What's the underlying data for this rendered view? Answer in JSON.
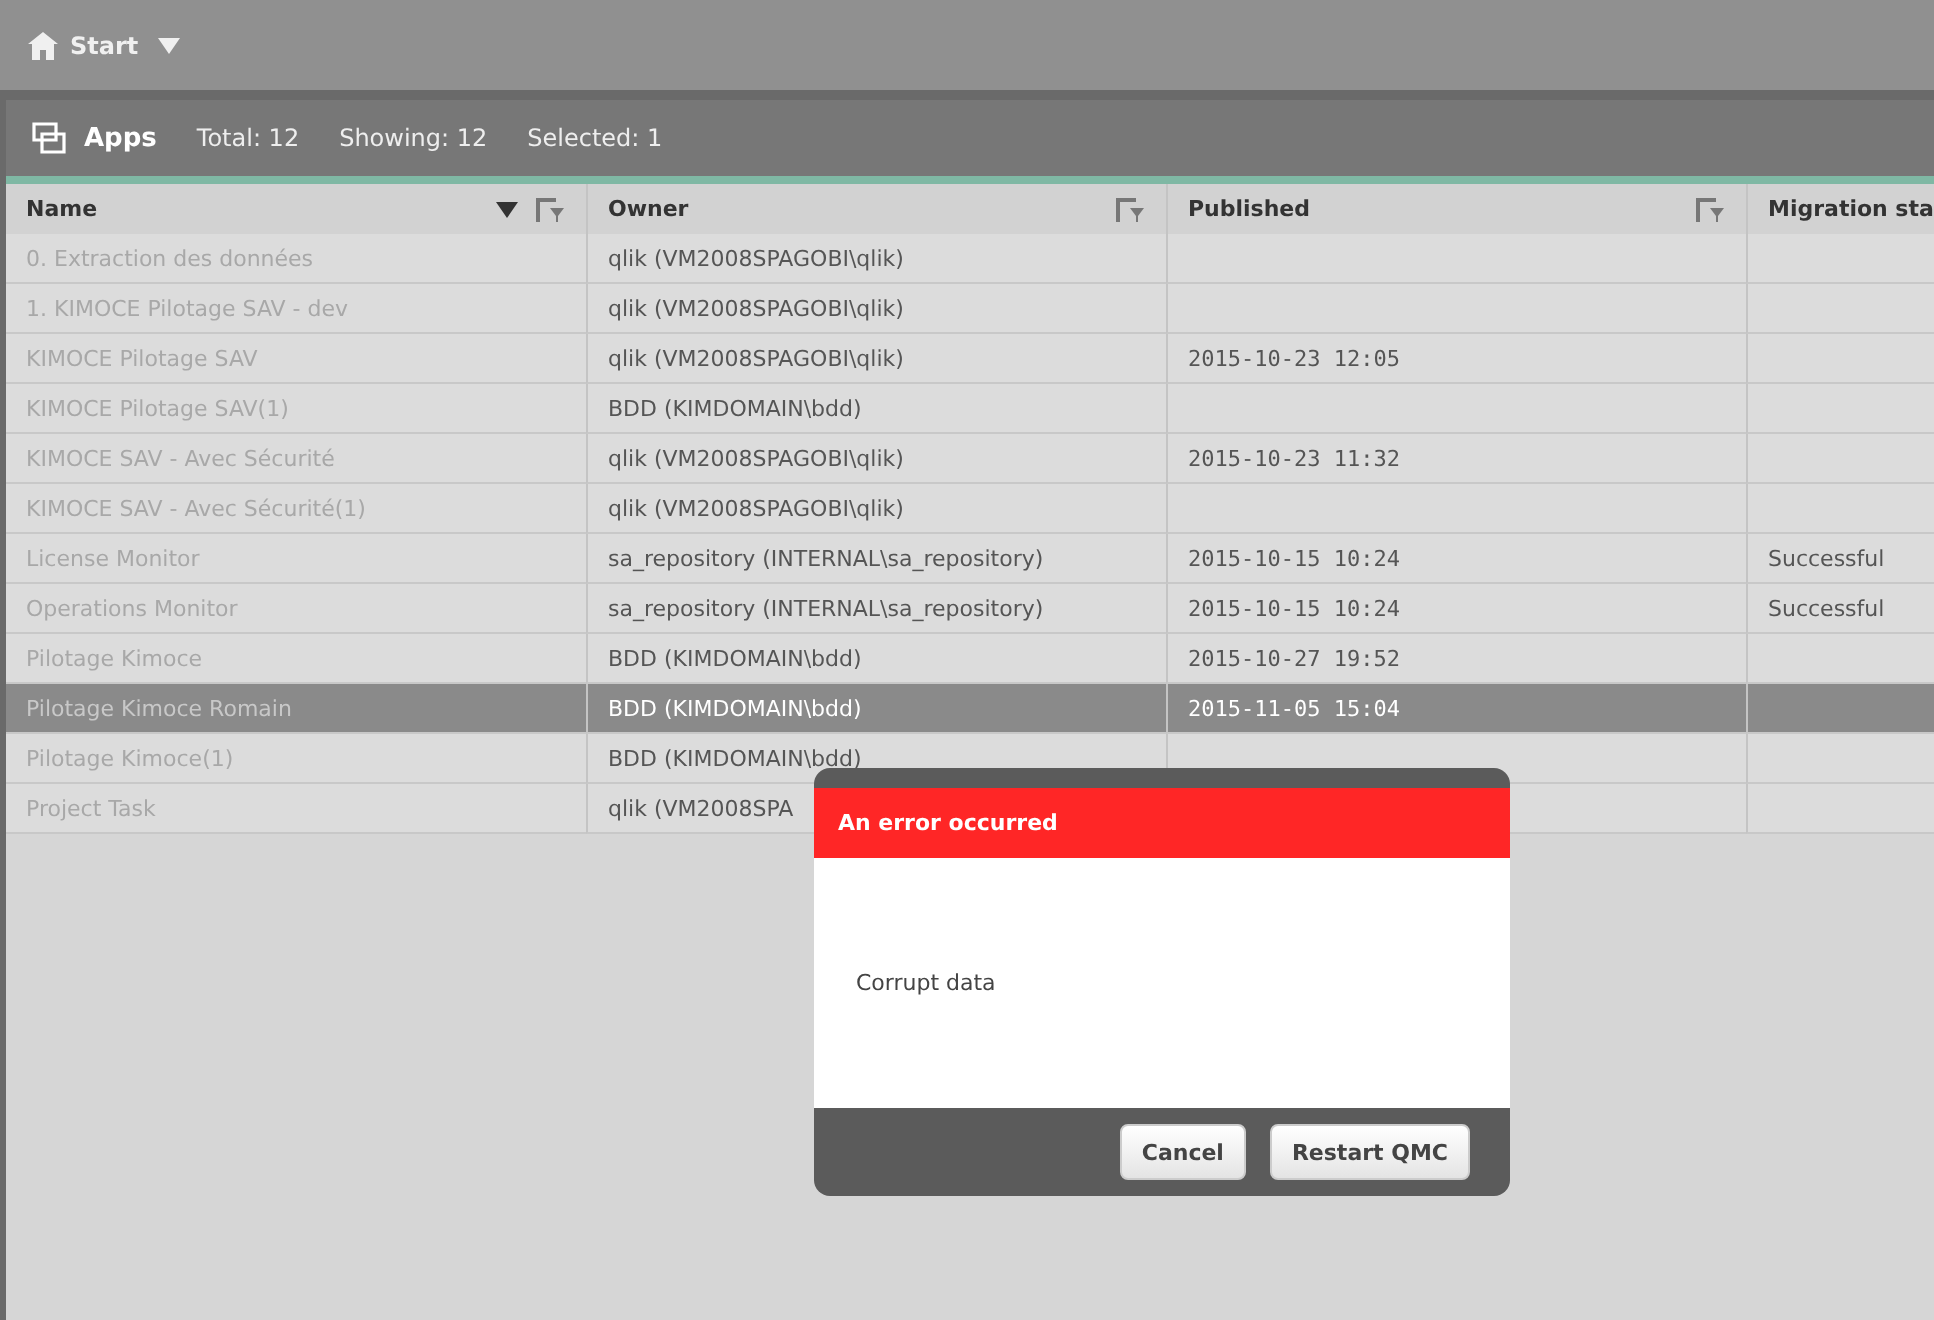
{
  "top_bar": {
    "home": "Start"
  },
  "apps_bar": {
    "title": "Apps",
    "total": "Total: 12",
    "showing": "Showing: 12",
    "selected": "Selected: 1"
  },
  "table": {
    "columns": [
      {
        "label": "Name",
        "sorted": true,
        "filter": true
      },
      {
        "label": "Owner",
        "sorted": false,
        "filter": true
      },
      {
        "label": "Published",
        "sorted": false,
        "filter": true
      },
      {
        "label": "Migration sta",
        "sorted": false,
        "filter": false
      }
    ],
    "rows": [
      {
        "name": "0. Extraction des données",
        "owner": "qlik (VM2008SPAGOBI\\qlik)",
        "published": "",
        "migration": "",
        "selected": false
      },
      {
        "name": "1. KIMOCE Pilotage SAV - dev",
        "owner": "qlik (VM2008SPAGOBI\\qlik)",
        "published": "",
        "migration": "",
        "selected": false
      },
      {
        "name": "KIMOCE Pilotage SAV",
        "owner": "qlik (VM2008SPAGOBI\\qlik)",
        "published": "2015-10-23 12:05",
        "migration": "",
        "selected": false
      },
      {
        "name": "KIMOCE Pilotage SAV(1)",
        "owner": "BDD (KIMDOMAIN\\bdd)",
        "published": "",
        "migration": "",
        "selected": false
      },
      {
        "name": "KIMOCE SAV - Avec Sécurité",
        "owner": "qlik (VM2008SPAGOBI\\qlik)",
        "published": "2015-10-23 11:32",
        "migration": "",
        "selected": false
      },
      {
        "name": "KIMOCE SAV - Avec Sécurité(1)",
        "owner": "qlik (VM2008SPAGOBI\\qlik)",
        "published": "",
        "migration": "",
        "selected": false
      },
      {
        "name": "License Monitor",
        "owner": "sa_repository (INTERNAL\\sa_repository)",
        "published": "2015-10-15 10:24",
        "migration": "Successful",
        "selected": false
      },
      {
        "name": "Operations Monitor",
        "owner": "sa_repository (INTERNAL\\sa_repository)",
        "published": "2015-10-15 10:24",
        "migration": "Successful",
        "selected": false
      },
      {
        "name": "Pilotage Kimoce",
        "owner": "BDD (KIMDOMAIN\\bdd)",
        "published": "2015-10-27 19:52",
        "migration": "",
        "selected": false
      },
      {
        "name": "Pilotage Kimoce Romain",
        "owner": "BDD (KIMDOMAIN\\bdd)",
        "published": "2015-11-05 15:04",
        "migration": "",
        "selected": true
      },
      {
        "name": "Pilotage Kimoce(1)",
        "owner": "BDD (KIMDOMAIN\\bdd)",
        "published": "",
        "migration": "",
        "selected": false
      },
      {
        "name": "Project Task",
        "owner": "qlik (VM2008SPA",
        "published": "",
        "migration": "",
        "selected": false
      }
    ]
  },
  "dialog": {
    "title": "An error occurred",
    "message": "Corrupt data",
    "buttons": [
      "Cancel",
      "Restart QMC"
    ]
  }
}
